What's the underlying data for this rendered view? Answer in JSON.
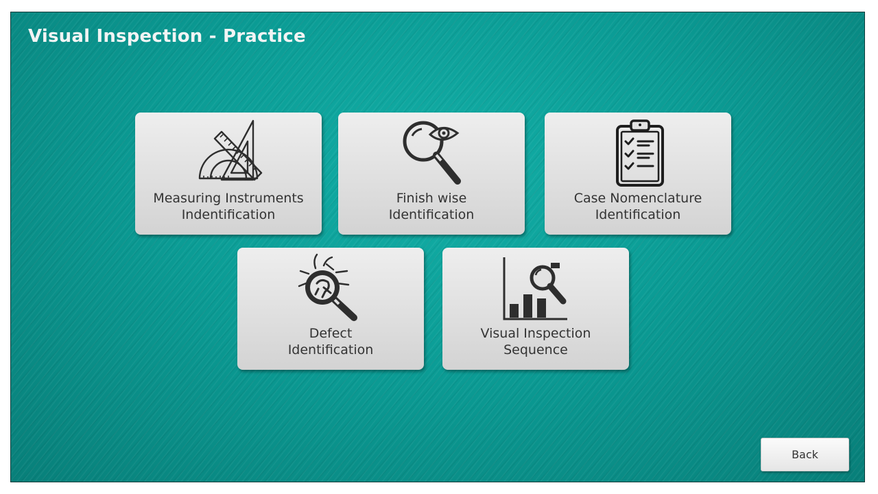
{
  "window": {
    "title": "Visual Inspection - Practice"
  },
  "tiles": [
    {
      "line1": "Measuring Instruments",
      "line2": "Indentification",
      "icon": "ruler-protractor-icon"
    },
    {
      "line1": "Finish wise",
      "line2": "Identification",
      "icon": "magnifier-eye-icon"
    },
    {
      "line1": "Case Nomenclature",
      "line2": "Identification",
      "icon": "checklist-clipboard-icon"
    },
    {
      "line1": "Defect",
      "line2": "Identification",
      "icon": "bug-magnifier-icon"
    },
    {
      "line1": "Visual Inspection",
      "line2": "Sequence",
      "icon": "chart-magnifier-icon"
    }
  ],
  "footer": {
    "back_label": "Back"
  },
  "colors": {
    "background": "#0b9c95",
    "tile": "#e2e2e2",
    "icon": "#3a3a3a",
    "title": "#f2f4f4"
  }
}
